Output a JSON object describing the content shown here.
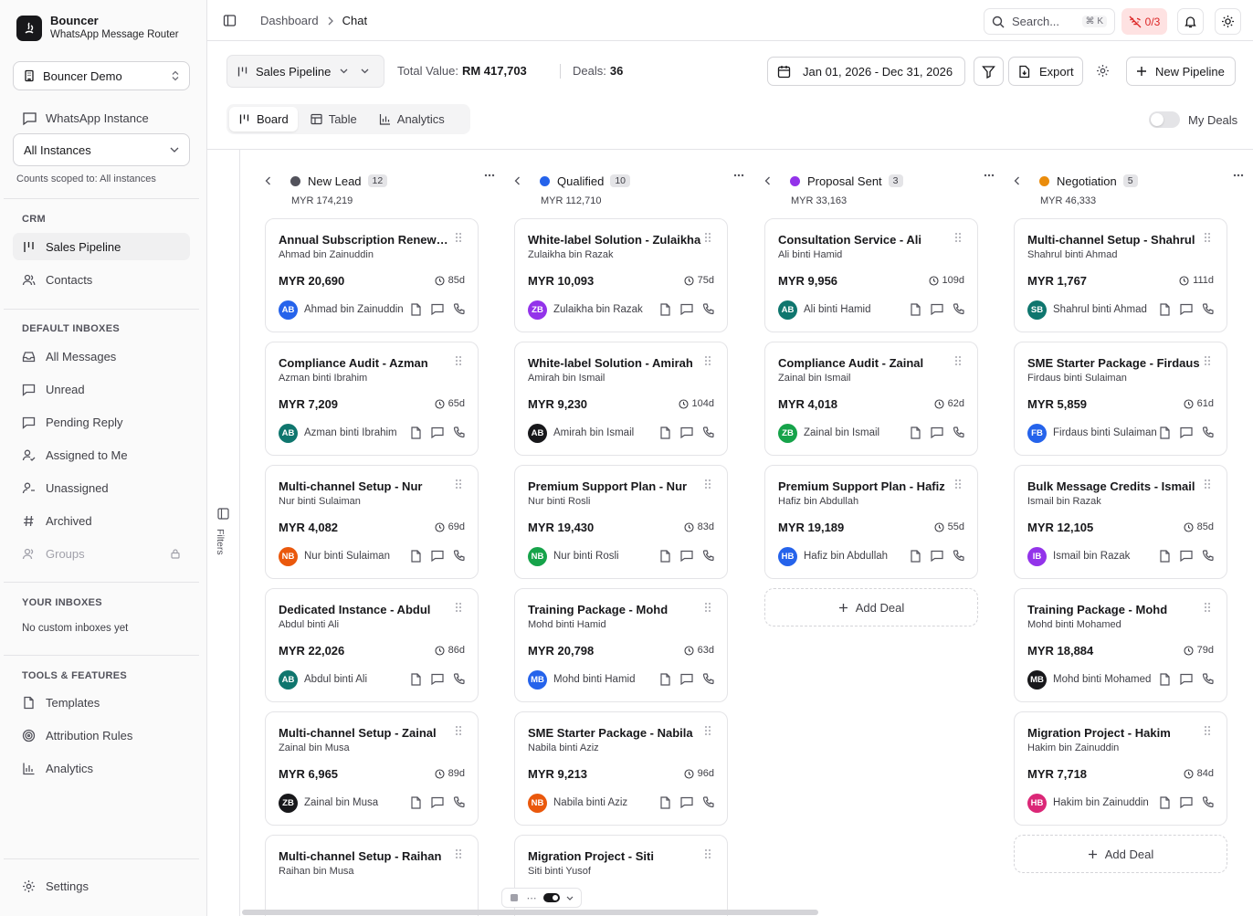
{
  "brand": {
    "name": "Bouncer",
    "subtitle": "WhatsApp Message Router"
  },
  "org": {
    "name": "Bouncer Demo"
  },
  "instances": {
    "label": "WhatsApp Instance",
    "selected": "All Instances",
    "scope_note": "Counts scoped to: All instances"
  },
  "crm": {
    "title": "CRM",
    "items": [
      {
        "label": "Sales Pipeline",
        "icon": "kanban-icon"
      },
      {
        "label": "Contacts",
        "icon": "users-icon"
      }
    ]
  },
  "default_inboxes": {
    "title": "DEFAULT INBOXES",
    "items": [
      {
        "label": "All Messages",
        "icon": "inbox-icon"
      },
      {
        "label": "Unread",
        "icon": "message-icon"
      },
      {
        "label": "Pending Reply",
        "icon": "message-icon"
      },
      {
        "label": "Assigned to Me",
        "icon": "user-check-icon"
      },
      {
        "label": "Unassigned",
        "icon": "user-x-icon"
      },
      {
        "label": "Archived",
        "icon": "hash-icon"
      },
      {
        "label": "Groups",
        "icon": "users-icon"
      }
    ]
  },
  "your_inboxes": {
    "title": "YOUR INBOXES",
    "empty": "No custom inboxes yet"
  },
  "tools": {
    "title": "TOOLS & FEATURES",
    "items": [
      {
        "label": "Templates",
        "icon": "file-icon"
      },
      {
        "label": "Attribution Rules",
        "icon": "target-icon"
      },
      {
        "label": "Analytics",
        "icon": "bar-chart-icon"
      }
    ]
  },
  "settings": {
    "label": "Settings"
  },
  "breadcrumb": {
    "parent": "Dashboard",
    "current": "Chat"
  },
  "search": {
    "placeholder": "Search...",
    "shortcut": "⌘ K"
  },
  "connection": {
    "status": "0/3",
    "color": "#dc2626"
  },
  "pipeline": {
    "name": "Sales Pipeline",
    "total_label": "Total Value:",
    "total_value": "RM 417,703",
    "deals_label": "Deals:",
    "deals_value": "36",
    "date_range": "Jan 01, 2026 - Dec 31, 2026",
    "export": "Export",
    "new_pipeline": "New Pipeline"
  },
  "view_tabs": [
    {
      "label": "Board",
      "icon": "kanban-icon"
    },
    {
      "label": "Table",
      "icon": "table-icon"
    },
    {
      "label": "Analytics",
      "icon": "bar-chart-icon"
    }
  ],
  "my_deals": {
    "label": "My Deals",
    "on": false
  },
  "filters_label": "Filters",
  "add_deal_label": "Add Deal",
  "columns": [
    {
      "name": "New Lead",
      "count": "12",
      "total": "MYR 174,219",
      "color": "#52525b",
      "cards": [
        {
          "title": "Annual Subscription Renewal - Ahmad",
          "subtitle": "Ahmad bin Zainuddin",
          "amount": "MYR 20,690",
          "age": "85d",
          "initials": "AB",
          "avatar_color": "#2563eb",
          "contact": "Ahmad bin Zainuddin"
        },
        {
          "title": "Compliance Audit - Azman",
          "subtitle": "Azman binti Ibrahim",
          "amount": "MYR 7,209",
          "age": "65d",
          "initials": "AB",
          "avatar_color": "#0f766e",
          "contact": "Azman binti Ibrahim"
        },
        {
          "title": "Multi-channel Setup - Nur",
          "subtitle": "Nur binti Sulaiman",
          "amount": "MYR 4,082",
          "age": "69d",
          "initials": "NB",
          "avatar_color": "#ea580c",
          "contact": "Nur binti Sulaiman"
        },
        {
          "title": "Dedicated Instance - Abdul",
          "subtitle": "Abdul binti Ali",
          "amount": "MYR 22,026",
          "age": "86d",
          "initials": "AB",
          "avatar_color": "#0f766e",
          "contact": "Abdul binti Ali"
        },
        {
          "title": "Multi-channel Setup - Zainal",
          "subtitle": "Zainal bin Musa",
          "amount": "MYR 6,965",
          "age": "89d",
          "initials": "ZB",
          "avatar_color": "#18181b",
          "contact": "Zainal bin Musa"
        },
        {
          "title": "Multi-channel Setup - Raihan",
          "subtitle": "Raihan bin Musa",
          "amount": "",
          "age": "",
          "initials": "",
          "avatar_color": "#fff",
          "contact": ""
        }
      ]
    },
    {
      "name": "Qualified",
      "count": "10",
      "total": "MYR 112,710",
      "color": "#2563eb",
      "cards": [
        {
          "title": "White-label Solution - Zulaikha",
          "subtitle": "Zulaikha bin Razak",
          "amount": "MYR 10,093",
          "age": "75d",
          "initials": "ZB",
          "avatar_color": "#9333ea",
          "contact": "Zulaikha bin Razak"
        },
        {
          "title": "White-label Solution - Amirah",
          "subtitle": "Amirah bin Ismail",
          "amount": "MYR 9,230",
          "age": "104d",
          "initials": "AB",
          "avatar_color": "#18181b",
          "contact": "Amirah bin Ismail"
        },
        {
          "title": "Premium Support Plan - Nur",
          "subtitle": "Nur binti Rosli",
          "amount": "MYR 19,430",
          "age": "83d",
          "initials": "NB",
          "avatar_color": "#16a34a",
          "contact": "Nur binti Rosli"
        },
        {
          "title": "Training Package - Mohd",
          "subtitle": "Mohd binti Hamid",
          "amount": "MYR 20,798",
          "age": "63d",
          "initials": "MB",
          "avatar_color": "#2563eb",
          "contact": "Mohd binti Hamid"
        },
        {
          "title": "SME Starter Package - Nabila",
          "subtitle": "Nabila binti Aziz",
          "amount": "MYR 9,213",
          "age": "96d",
          "initials": "NB",
          "avatar_color": "#ea580c",
          "contact": "Nabila binti Aziz"
        },
        {
          "title": "Migration Project - Siti",
          "subtitle": "Siti binti Yusof",
          "amount": "",
          "age": "",
          "initials": "",
          "avatar_color": "#fff",
          "contact": ""
        }
      ]
    },
    {
      "name": "Proposal Sent",
      "count": "3",
      "total": "MYR 33,163",
      "color": "#9333ea",
      "cards": [
        {
          "title": "Consultation Service - Ali",
          "subtitle": "Ali binti Hamid",
          "amount": "MYR 9,956",
          "age": "109d",
          "initials": "AB",
          "avatar_color": "#0f766e",
          "contact": "Ali binti Hamid"
        },
        {
          "title": "Compliance Audit - Zainal",
          "subtitle": "Zainal bin Ismail",
          "amount": "MYR 4,018",
          "age": "62d",
          "initials": "ZB",
          "avatar_color": "#16a34a",
          "contact": "Zainal bin Ismail"
        },
        {
          "title": "Premium Support Plan - Hafiz",
          "subtitle": "Hafiz bin Abdullah",
          "amount": "MYR 19,189",
          "age": "55d",
          "initials": "HB",
          "avatar_color": "#2563eb",
          "contact": "Hafiz bin Abdullah"
        }
      ]
    },
    {
      "name": "Negotiation",
      "count": "5",
      "total": "MYR 46,333",
      "color": "#ea8c0c",
      "cards": [
        {
          "title": "Multi-channel Setup - Shahrul",
          "subtitle": "Shahrul binti Ahmad",
          "amount": "MYR 1,767",
          "age": "111d",
          "initials": "SB",
          "avatar_color": "#0f766e",
          "contact": "Shahrul binti Ahmad"
        },
        {
          "title": "SME Starter Package - Firdaus",
          "subtitle": "Firdaus binti Sulaiman",
          "amount": "MYR 5,859",
          "age": "61d",
          "initials": "FB",
          "avatar_color": "#2563eb",
          "contact": "Firdaus binti Sulaiman"
        },
        {
          "title": "Bulk Message Credits - Ismail",
          "subtitle": "Ismail bin Razak",
          "amount": "MYR 12,105",
          "age": "85d",
          "initials": "IB",
          "avatar_color": "#9333ea",
          "contact": "Ismail bin Razak"
        },
        {
          "title": "Training Package - Mohd",
          "subtitle": "Mohd binti Mohamed",
          "amount": "MYR 18,884",
          "age": "79d",
          "initials": "MB",
          "avatar_color": "#18181b",
          "contact": "Mohd binti Mohamed"
        },
        {
          "title": "Migration Project - Hakim",
          "subtitle": "Hakim bin Zainuddin",
          "amount": "MYR 7,718",
          "age": "84d",
          "initials": "HB",
          "avatar_color": "#db2777",
          "contact": "Hakim bin Zainuddin"
        }
      ]
    }
  ]
}
